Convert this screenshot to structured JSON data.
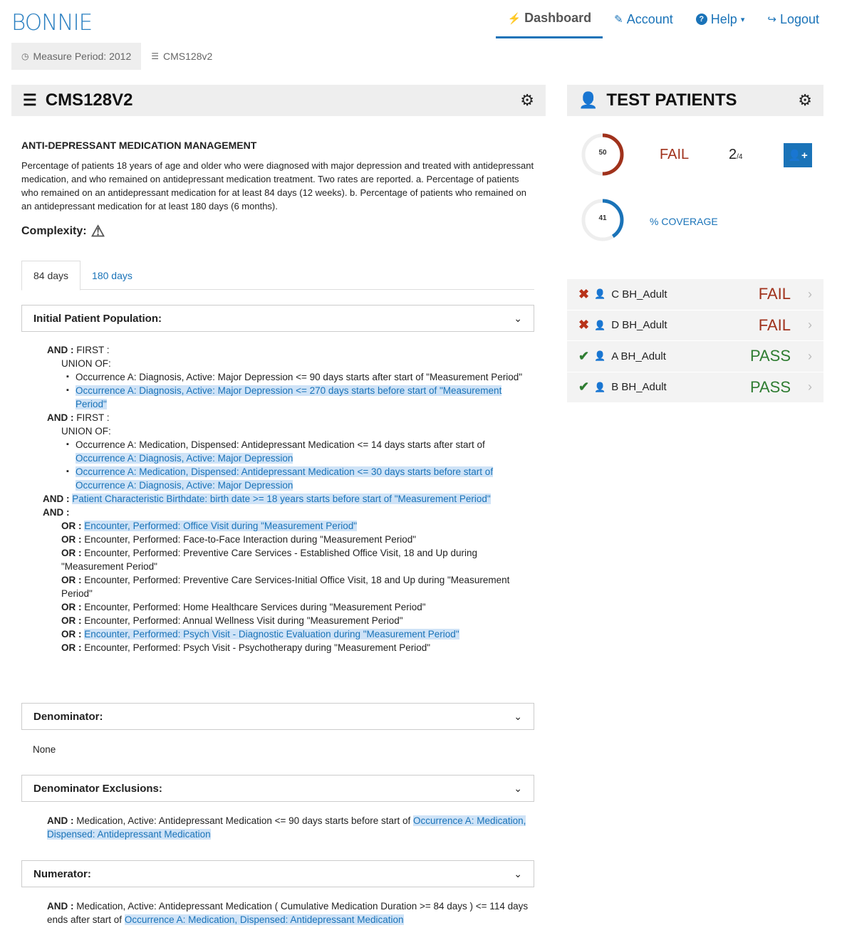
{
  "app": {
    "logo": "BONNIE"
  },
  "nav": [
    {
      "icon": "⚡",
      "label": "Dashboard",
      "active": true
    },
    {
      "icon": "✎",
      "label": "Account"
    },
    {
      "icon": "?",
      "label": "Help",
      "caret": "▾"
    },
    {
      "icon": "↪",
      "label": "Logout"
    }
  ],
  "breadcrumb": {
    "period": "Measure Period: 2012",
    "measure": "CMS128v2"
  },
  "measure": {
    "id": "CMS128V2",
    "title": "ANTI-DEPRESSANT MEDICATION MANAGEMENT",
    "description": "Percentage of patients 18 years of age and older who were diagnosed with major depression and treated with antidepressant medication, and who remained on antidepressant medication treatment. Two rates are reported. a. Percentage of patients who remained on an antidepressant medication for at least 84 days (12 weeks). b. Percentage of patients who remained on an antidepressant medication for at least 180 days (6 months).",
    "complexity_label": "Complexity:",
    "tabs": [
      "84 days",
      "180 days"
    ]
  },
  "sections": {
    "ipp": {
      "title": "Initial Patient Population:"
    },
    "denominator": {
      "title": "Denominator:",
      "body": "None"
    },
    "denex": {
      "title": "Denominator Exclusions:"
    },
    "numerator": {
      "title": "Numerator:"
    }
  },
  "logic": {
    "and": "AND :",
    "and_first": "AND :",
    "first": " FIRST :",
    "union": "UNION OF:",
    "or": "OR :",
    "ipp_b1": "Occurrence A: Diagnosis, Active: Major Depression <= 90 days starts after start of \"Measurement Period\"",
    "ipp_b2": "Occurrence A: Diagnosis, Active: Major Depression <= 270 days starts before start of \"Measurement Period\"",
    "ipp_b3a": "Occurrence A: Medication, Dispensed: Antidepressant Medication <= 14 days starts after start of ",
    "ipp_b3b": "Occurrence A: Diagnosis, Active: Major Depression",
    "ipp_b4": "Occurrence A: Medication, Dispensed: Antidepressant Medication <= 30 days starts before start of Occurrence A: Diagnosis, Active: Major Depression",
    "ipp_birth": "Patient Characteristic Birthdate: birth date >= 18 years starts before start of \"Measurement Period\"",
    "or1": "Encounter, Performed: Office Visit during \"Measurement Period\"",
    "or2": "Encounter, Performed: Face-to-Face Interaction during \"Measurement Period\"",
    "or3": "Encounter, Performed: Preventive Care Services - Established Office Visit, 18 and Up during \"Measurement Period\"",
    "or4": "Encounter, Performed: Preventive Care Services-Initial Office Visit, 18 and Up during \"Measurement Period\"",
    "or5": "Encounter, Performed: Home Healthcare Services during \"Measurement Period\"",
    "or6": "Encounter, Performed: Annual Wellness Visit during \"Measurement Period\"",
    "or7": "Encounter, Performed: Psych Visit - Diagnostic Evaluation during \"Measurement Period\"",
    "or8": "Encounter, Performed: Psych Visit - Psychotherapy during \"Measurement Period\"",
    "denex_a": " Medication, Active: Antidepressant Medication <= 90 days starts before start of ",
    "denex_b": "Occurrence A: Medication, Dispensed: Antidepressant Medication",
    "num_a": " Medication, Active: Antidepressant Medication ( Cumulative Medication Duration >= 84 days ) <= 114 days ends after start of ",
    "num_b": "Occurrence A: Medication, Dispensed: Antidepressant Medication"
  },
  "patients": {
    "title": "TEST PATIENTS",
    "pass_rate": 50,
    "status": "FAIL",
    "count": "2",
    "count_total": "/4",
    "add_label": "+",
    "coverage": 41,
    "coverage_label": "% COVERAGE",
    "colors": {
      "fail": "#a0321c",
      "pass": "#2f7d32",
      "accent": "#1a73b8"
    },
    "list": [
      {
        "name": "C BH_Adult",
        "result": "FAIL",
        "icon": "✖"
      },
      {
        "name": "D BH_Adult",
        "result": "FAIL",
        "icon": "✖"
      },
      {
        "name": "A BH_Adult",
        "result": "PASS",
        "icon": "✔"
      },
      {
        "name": "B BH_Adult",
        "result": "PASS",
        "icon": "✔"
      }
    ]
  }
}
